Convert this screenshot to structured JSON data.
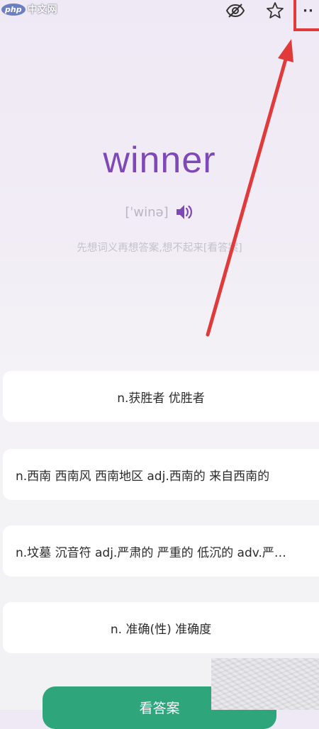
{
  "watermark": {
    "badge": "php",
    "text": "中文网"
  },
  "topbar": {
    "icons": [
      "eye-slash-icon",
      "star-icon",
      "more-icon"
    ],
    "more_label": "··"
  },
  "word": {
    "text": "winner",
    "phonetic": "[ˈwinə]",
    "hint": "先想词义再想答案,想不起来[看答案]"
  },
  "options": [
    {
      "label": "n.获胜者 优胜者"
    },
    {
      "label": "n.西南 西南风 西南地区 adj.西南的 来自西南的"
    },
    {
      "label": "n.坟墓 沉音符 adj.严肃的 严重的 低沉的 adv.严肃地"
    },
    {
      "label": "n. 准确(性) 准确度"
    }
  ],
  "footer": {
    "answer_button": "看答案"
  },
  "colors": {
    "word": "#7e48b6",
    "annotation": "#e03a3a",
    "button": "#2fa57b"
  }
}
